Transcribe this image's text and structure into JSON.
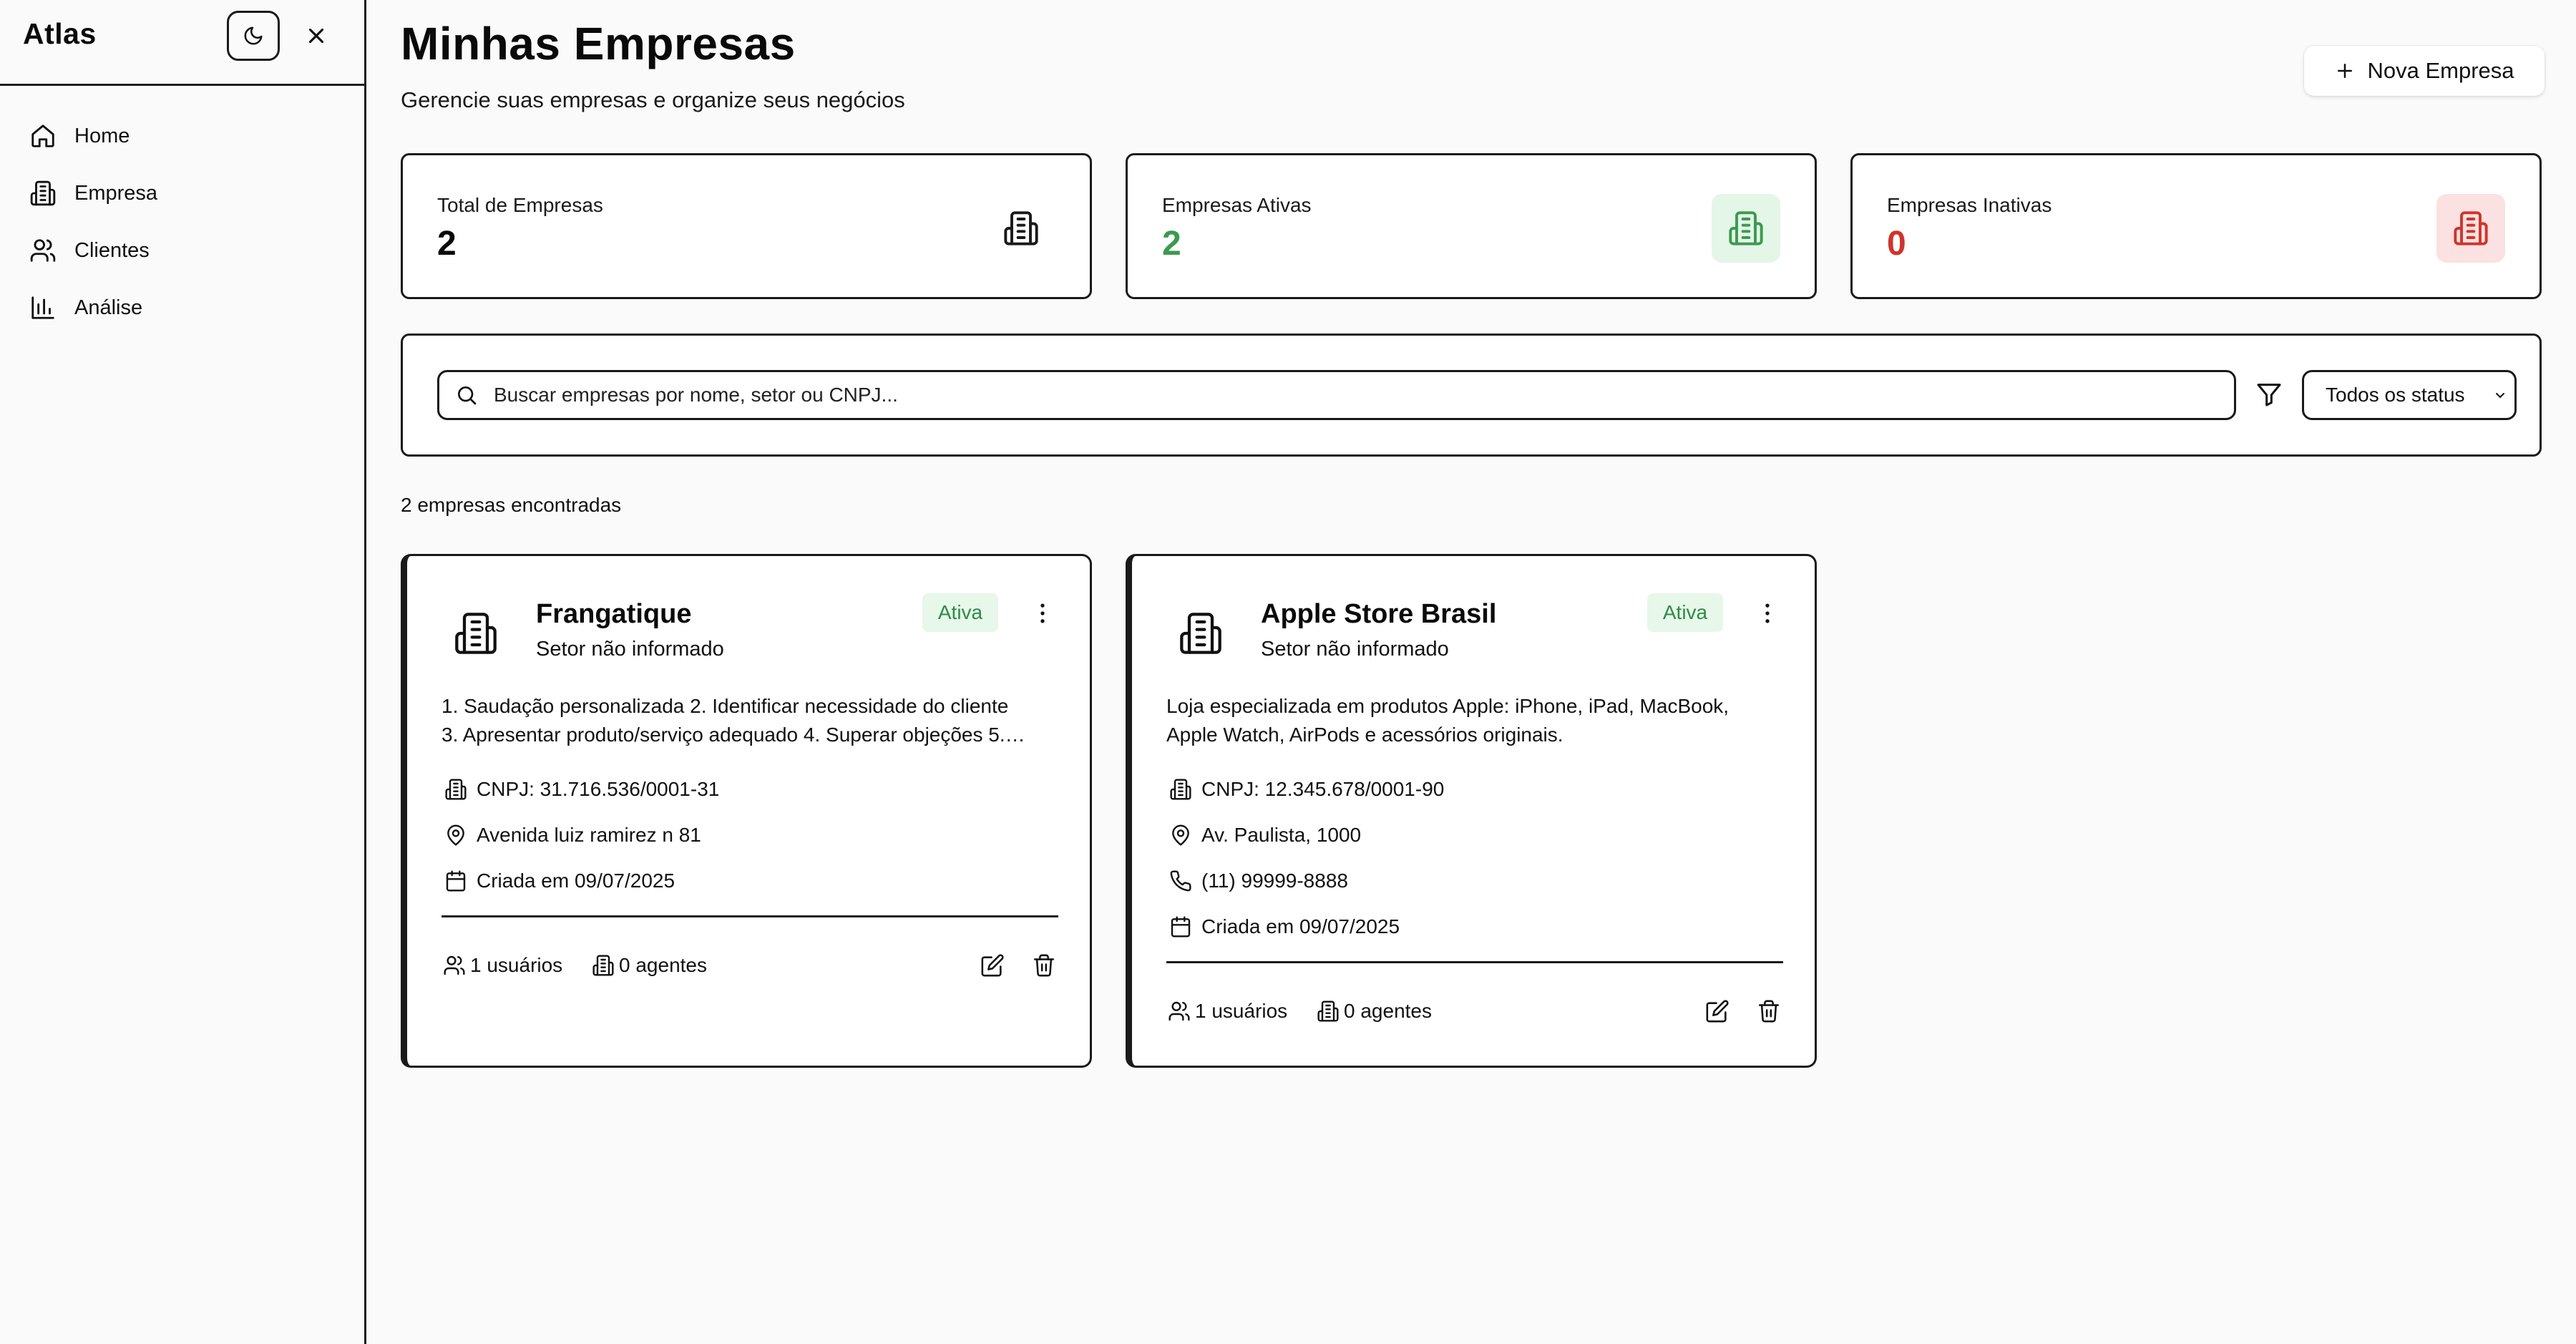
{
  "sidebar": {
    "brand": "Atlas",
    "theme_toggle_icon": "moon-icon",
    "close_icon": "close-icon",
    "items": [
      {
        "label": "Home",
        "icon": "home-icon"
      },
      {
        "label": "Empresa",
        "icon": "building-icon"
      },
      {
        "label": "Clientes",
        "icon": "users-icon"
      },
      {
        "label": "Análise",
        "icon": "bar-chart-icon"
      }
    ]
  },
  "header": {
    "title": "Minhas Empresas",
    "subtitle": "Gerencie suas empresas e organize seus negócios",
    "new_button_label": "Nova Empresa"
  },
  "stats": [
    {
      "label": "Total de Empresas",
      "value": "2",
      "color": "#0a0a0a",
      "icon_bg": "#ffffff",
      "icon_color": "#1a1a1a"
    },
    {
      "label": "Empresas Ativas",
      "value": "2",
      "color": "#3c9a4f",
      "icon_bg": "#e4f6e8",
      "icon_color": "#3c9a4f"
    },
    {
      "label": "Empresas Inativas",
      "value": "0",
      "color": "#d0342c",
      "icon_bg": "#fbe1e1",
      "icon_color": "#d0342c"
    }
  ],
  "filters": {
    "search_placeholder": "Buscar empresas por nome, setor ou CNPJ...",
    "search_value": "",
    "status_selected": "Todos os status"
  },
  "results_count": "2 empresas encontradas",
  "companies": [
    {
      "name": "Frangatique",
      "sector": "Setor não informado",
      "status": "Ativa",
      "description_lines": [
        "1. Saudação personalizada 2. Identificar necessidade do cliente",
        "3. Apresentar produto/serviço adequado 4. Superar objeções 5.…"
      ],
      "cnpj": "CNPJ: 31.716.536/0001-31",
      "address": "Avenida luiz ramirez n 81",
      "created": "Criada em 09/07/2025",
      "users": "1 usuários",
      "agents": "0 agentes"
    },
    {
      "name": "Apple Store Brasil",
      "sector": "Setor não informado",
      "status": "Ativa",
      "description_lines": [
        "Loja especializada em produtos Apple: iPhone, iPad, MacBook,",
        "Apple Watch, AirPods e acessórios originais."
      ],
      "cnpj": "CNPJ: 12.345.678/0001-90",
      "address": "Av. Paulista, 1000",
      "phone": "(11) 99999-8888",
      "created": "Criada em 09/07/2025",
      "users": "1 usuários",
      "agents": "0 agentes"
    }
  ],
  "colors": {
    "active_badge_bg": "#e7f7ea",
    "active_badge_text": "#2f8a45",
    "border": "#1a1a1a"
  }
}
